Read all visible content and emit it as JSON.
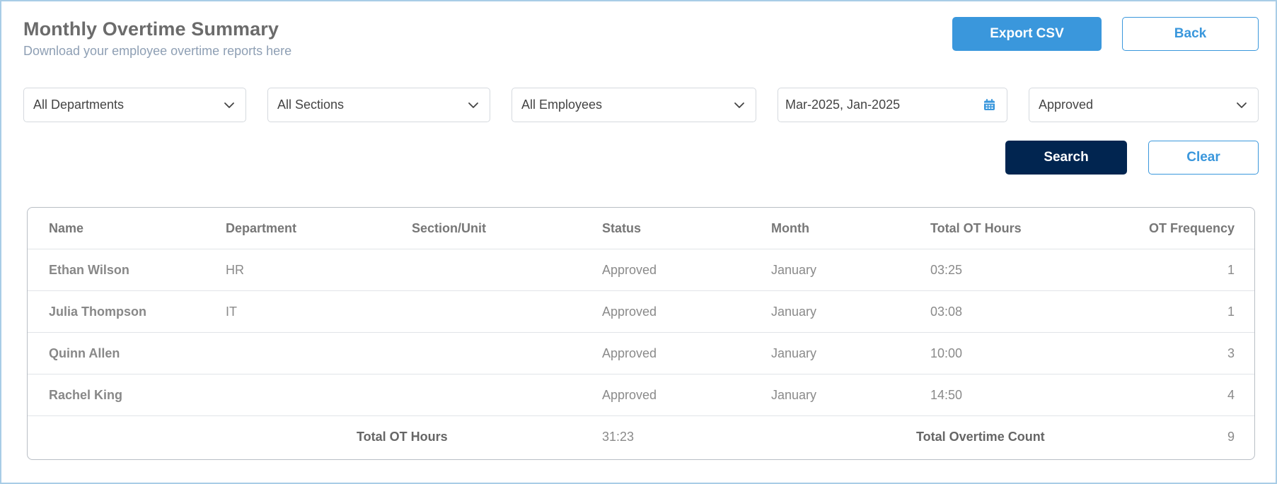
{
  "header": {
    "title": "Monthly Overtime Summary",
    "subtitle": "Download your employee overtime reports here",
    "export_label": "Export CSV",
    "back_label": "Back"
  },
  "filters": {
    "department": "All Departments",
    "section": "All Sections",
    "employee": "All Employees",
    "date_range": "Mar-2025, Jan-2025",
    "status": "Approved",
    "search_label": "Search",
    "clear_label": "Clear"
  },
  "table": {
    "columns": [
      "Name",
      "Department",
      "Section/Unit",
      "Status",
      "Month",
      "Total OT Hours",
      "OT Frequency"
    ],
    "rows": [
      {
        "name": "Ethan Wilson",
        "department": "HR",
        "section": "",
        "status": "Approved",
        "month": "January",
        "hours": "03:25",
        "frequency": "1"
      },
      {
        "name": "Julia Thompson",
        "department": "IT",
        "section": "",
        "status": "Approved",
        "month": "January",
        "hours": "03:08",
        "frequency": "1"
      },
      {
        "name": "Quinn Allen",
        "department": "",
        "section": "",
        "status": "Approved",
        "month": "January",
        "hours": "10:00",
        "frequency": "3"
      },
      {
        "name": "Rachel King",
        "department": "",
        "section": "",
        "status": "Approved",
        "month": "January",
        "hours": "14:50",
        "frequency": "4"
      }
    ],
    "footer": {
      "total_hours_label": "Total OT Hours",
      "total_hours_value": "31:23",
      "total_count_label": "Total Overtime Count",
      "total_count_value": "9"
    }
  },
  "colors": {
    "primary": "#3a97dc",
    "search_button": "#012550",
    "frame_border": "#a9cde6"
  },
  "icons": {
    "select_chevron": "chevron-down-icon",
    "date_picker": "calendar-icon"
  }
}
